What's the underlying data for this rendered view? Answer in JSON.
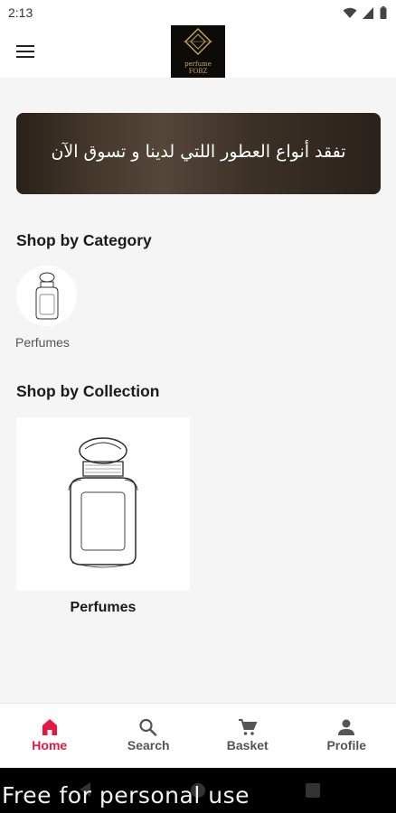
{
  "status_bar": {
    "time": "2:13"
  },
  "app_bar": {
    "logo_text_line1": "perfume",
    "logo_text_line2": "FOBZ"
  },
  "banner": {
    "text": "تفقد أنواع العطور اللتي لدينا و تسوق الآن"
  },
  "category_section": {
    "title": "Shop by Category",
    "items": [
      {
        "label": "Perfumes",
        "icon": "perfume-bottle-icon"
      }
    ]
  },
  "collection_section": {
    "title": "Shop by Collection",
    "items": [
      {
        "label": "Perfumes",
        "icon": "perfume-bottle-icon"
      }
    ]
  },
  "bottom_nav": {
    "items": [
      {
        "label": "Home",
        "icon": "home-icon",
        "active": true
      },
      {
        "label": "Search",
        "icon": "search-icon",
        "active": false
      },
      {
        "label": "Basket",
        "icon": "cart-icon",
        "active": false
      },
      {
        "label": "Profile",
        "icon": "person-icon",
        "active": false
      }
    ]
  },
  "watermark": "Free for personal use",
  "colors": {
    "accent": "#e8173f",
    "logo_gold": "#c9a55a",
    "background": "#f5f5f5"
  }
}
